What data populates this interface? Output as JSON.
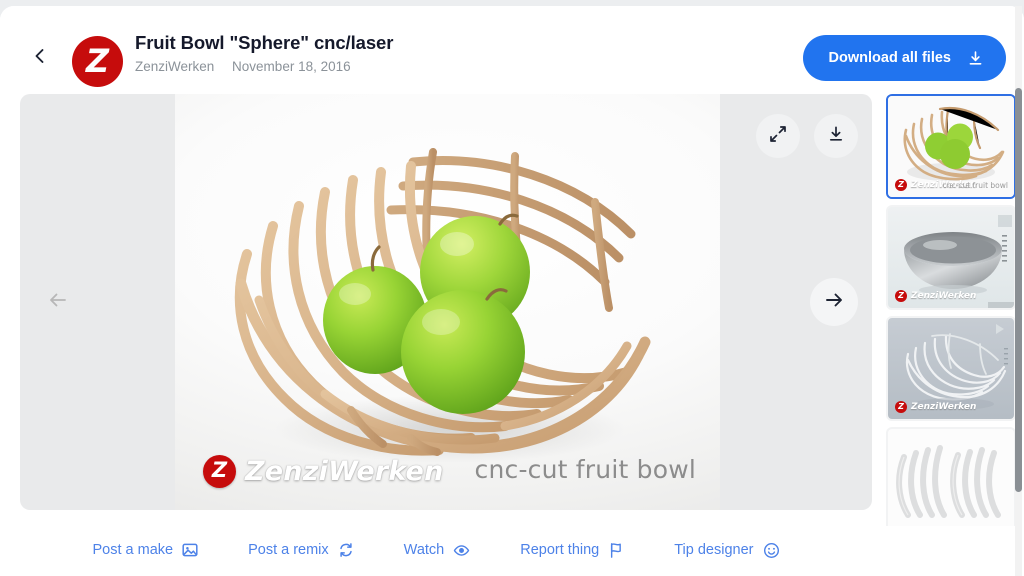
{
  "header": {
    "back_icon": "chevron-left-icon",
    "avatar_letter": "Z",
    "title": "Fruit Bowl \"Sphere\" cnc/laser",
    "author": "ZenziWerken",
    "date": "November 18, 2016",
    "download_all_label": "Download all files",
    "download_all_icon": "download-icon",
    "accent_color": "#2174ef"
  },
  "viewer": {
    "expand_icon": "expand-icon",
    "download_icon": "download-icon",
    "prev_icon": "arrow-left-icon",
    "next_icon": "arrow-right-icon",
    "watermark_brand": "ZenziWerken",
    "watermark_badge_letter": "Z",
    "watermark_caption": "cnc-cut fruit bowl",
    "brand_color": "#c60c0c"
  },
  "thumbnails": [
    {
      "alt": "cnc-cut wooden fruit bowl with three green apples",
      "selected": true,
      "watermark_brand": "ZenziWerken",
      "caption": "cnc-cut fruit bowl"
    },
    {
      "alt": "grey metallic sphere bowl cad render",
      "selected": false,
      "watermark_brand": "ZenziWerken",
      "caption": ""
    },
    {
      "alt": "wireframe slat bowl cad render",
      "selected": false,
      "watermark_brand": "ZenziWerken",
      "caption": ""
    },
    {
      "alt": "flat cnc cut rib pieces layout",
      "selected": false,
      "watermark_brand": "",
      "caption": ""
    }
  ],
  "actions": [
    {
      "label": "Post a make",
      "icon": "image-icon"
    },
    {
      "label": "Post a remix",
      "icon": "remix-icon"
    },
    {
      "label": "Watch",
      "icon": "eye-icon"
    },
    {
      "label": "Report thing",
      "icon": "flag-icon"
    },
    {
      "label": "Tip designer",
      "icon": "smiley-icon"
    }
  ],
  "action_color": "#4d82e8"
}
